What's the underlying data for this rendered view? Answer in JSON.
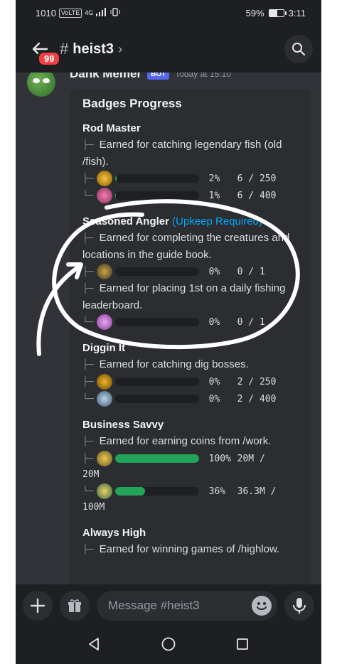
{
  "status_bar": {
    "left_text": "1010",
    "net_label": "VoLTE",
    "net_gen": "4G",
    "battery_text": "59%",
    "battery_level": 0.59,
    "time": "3:11"
  },
  "header": {
    "unread_count": "99",
    "channel_name": "heist3",
    "icons": [
      "back-arrow-icon",
      "hash-icon",
      "chevron-right-icon",
      "search-icon"
    ]
  },
  "message": {
    "author": "Dank Memer",
    "bot_tag": "BOT",
    "timestamp": "Today at 15:10"
  },
  "embed": {
    "title": "Badges Progress",
    "badges": [
      {
        "name": "Rod Master",
        "upkeep": "",
        "desc": "Earned for catching legendary fish (old /fish).",
        "rows": [
          {
            "percent": "2%",
            "amount": "6 / 250",
            "fill": 0.02
          },
          {
            "percent": "1%",
            "amount": "6 / 400",
            "fill": 0.01
          }
        ]
      },
      {
        "name": "Seasoned Angler",
        "upkeep": "(Upkeep Required)",
        "desc": "Earned for completing the creatures and locations in the guide book.",
        "rows": [
          {
            "percent": "0%",
            "amount": "0 / 1",
            "fill": 0
          }
        ],
        "desc2": "Earned for placing 1st on a daily fishing leaderboard.",
        "rows2": [
          {
            "percent": "0%",
            "amount": "0 / 1",
            "fill": 0
          }
        ]
      },
      {
        "name": "Diggin It",
        "upkeep": "",
        "desc": "Earned for catching dig bosses.",
        "rows": [
          {
            "percent": "0%",
            "amount": "2 / 250",
            "fill": 0
          },
          {
            "percent": "0%",
            "amount": "2 / 400",
            "fill": 0
          }
        ]
      },
      {
        "name": "Business Savvy",
        "upkeep": "",
        "desc": "Earned for earning coins from /work.",
        "rows": [
          {
            "percent": "100%",
            "amount": "20M /",
            "wrap": "20M",
            "fill": 1.0
          },
          {
            "percent": "36%",
            "amount": "36.3M /",
            "wrap": "100M",
            "fill": 0.36
          }
        ]
      },
      {
        "name": "Always High",
        "upkeep": "",
        "desc": "Earned for winning games of /highlow.",
        "rows": []
      }
    ]
  },
  "composer": {
    "placeholder": "Message #heist3"
  },
  "colors": {
    "progress_green": "#23a559",
    "upkeep_blue": "#00a8fc",
    "bot_tag": "#5865f2",
    "unread_red": "#f23f43"
  }
}
